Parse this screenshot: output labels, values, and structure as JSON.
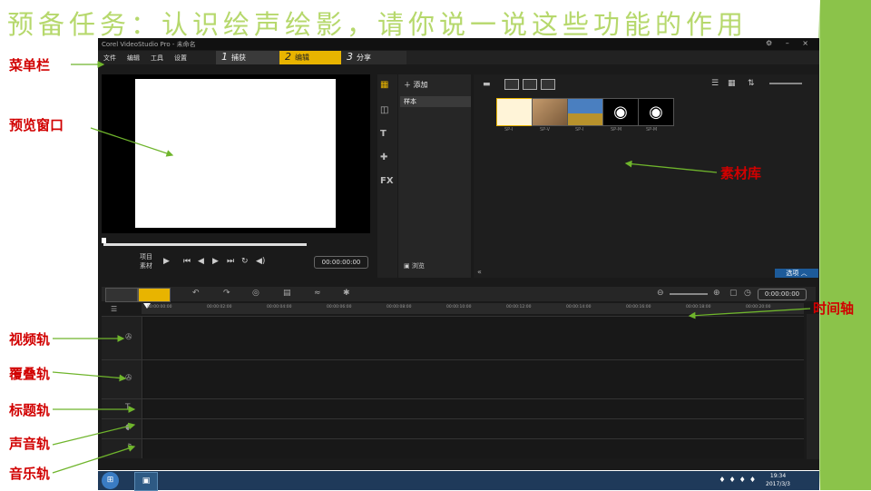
{
  "heading": "预备任务：认识绘声绘影，请你说一说这些功能的作用",
  "window": {
    "title": "Corel VideoStudio Pro - 未命名",
    "controls": "⚙ – ×"
  },
  "menubar": {
    "items": [
      "文件",
      "编辑",
      "工具",
      "设置"
    ]
  },
  "steps": [
    {
      "num": "1",
      "label": "捕获"
    },
    {
      "num": "2",
      "label": "编辑"
    },
    {
      "num": "3",
      "label": "分享"
    }
  ],
  "preview": {
    "mode_label_1": "项目",
    "mode_label_2": "素材",
    "timecode": "00:00:00:00"
  },
  "library": {
    "add_label": "添加",
    "item": "样本",
    "browse_label": "浏览",
    "options_label": "选项",
    "thumb_labels": [
      "SP-I",
      "SP-V",
      "SP-I",
      "SP-M",
      "SP-M"
    ]
  },
  "timeline": {
    "timecode": "0:00:00:00",
    "ticks": [
      "00:00:00:00",
      "00:00:02:00",
      "00:00:04:00",
      "00:00:06:00",
      "00:00:08:00",
      "00:00:10:00",
      "00:00:12:00",
      "00:00:14:00",
      "00:00:16:00",
      "00:00:18:00",
      "00:00:20:00"
    ]
  },
  "taskbar": {
    "time": "19:34",
    "date": "2017/3/3"
  },
  "labels": {
    "menubar": "菜单栏",
    "preview": "预览窗口",
    "library": "素材库",
    "timeline": "时间轴",
    "video_track": "视频轨",
    "overlay_track": "覆叠轨",
    "title_track": "标题轨",
    "voice_track": "声音轨",
    "music_track": "音乐轨"
  },
  "colors": {
    "heading": "#b6d86c",
    "label": "#d10000",
    "arrow": "#6fb52c",
    "accent": "#e8b400"
  }
}
